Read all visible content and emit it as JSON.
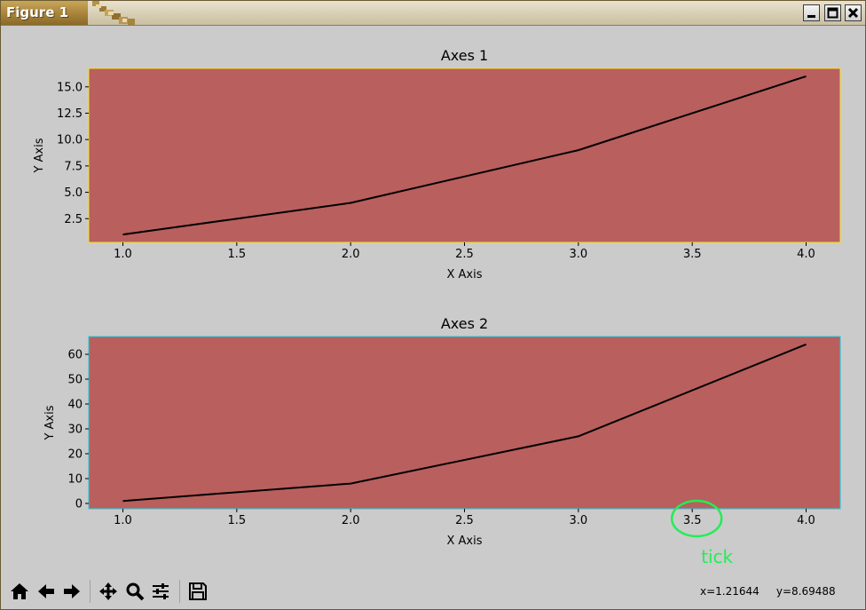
{
  "window": {
    "title": "Figure 1",
    "controls": [
      "minimize",
      "maximize",
      "close"
    ]
  },
  "chart_data": [
    {
      "type": "line",
      "title": "Axes 1",
      "xlabel": "X Axis",
      "ylabel": "Y Axis",
      "x": [
        1.0,
        2.0,
        3.0,
        4.0
      ],
      "series": [
        {
          "values": [
            1,
            4,
            9,
            16
          ],
          "color": "#000000"
        }
      ],
      "xlim": [
        0.85,
        4.15
      ],
      "ylim": [
        0.25,
        16.75
      ],
      "xticks": [
        "1.0",
        "1.5",
        "2.0",
        "2.5",
        "3.0",
        "3.5",
        "4.0"
      ],
      "yticks": [
        "2.5",
        "5.0",
        "7.5",
        "10.0",
        "12.5",
        "15.0"
      ],
      "facecolor": "#b95f5d",
      "edgecolor": "#f2e227",
      "grid": false
    },
    {
      "type": "line",
      "title": "Axes 2",
      "xlabel": "X Axis",
      "ylabel": "Y Axis",
      "x": [
        1.0,
        2.0,
        3.0,
        4.0
      ],
      "series": [
        {
          "values": [
            1,
            8,
            27,
            64
          ],
          "color": "#000000"
        }
      ],
      "xlim": [
        0.85,
        4.15
      ],
      "ylim": [
        -2.15,
        67.15
      ],
      "xticks": [
        "1.0",
        "1.5",
        "2.0",
        "2.5",
        "3.0",
        "3.5",
        "4.0"
      ],
      "yticks": [
        "0",
        "10",
        "20",
        "30",
        "40",
        "50",
        "60"
      ],
      "facecolor": "#b95f5d",
      "edgecolor": "#22c9df",
      "grid": false
    }
  ],
  "annotation": {
    "text": "tick",
    "color": "#22ee55",
    "target_tick": "3.5"
  },
  "toolbar": {
    "buttons": [
      "home",
      "back",
      "forward",
      "pan",
      "zoom",
      "configure-subplots",
      "save"
    ],
    "coordinates": "x=1.21644     y=8.69488"
  },
  "colors": {
    "figure_background": "#cbcbcb",
    "title_gold": "#b08a3e"
  }
}
